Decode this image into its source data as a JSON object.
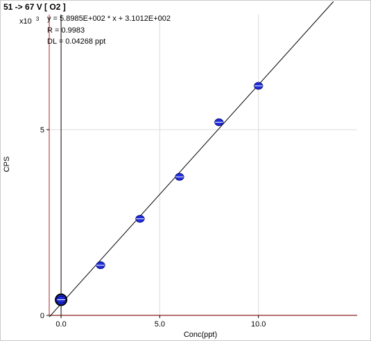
{
  "chart_data": {
    "type": "scatter",
    "title": "51 -> 67  V  [ O2 ]",
    "xlabel": "Conc(ppt)",
    "ylabel": "CPS",
    "y_scale_label": "x10",
    "y_scale_exponent": "3",
    "annotations": [
      "y = 5.8985E+002 * x  + 3.1012E+002",
      "R = 0.9983",
      "DL = 0.04268 ppt"
    ],
    "xlim": [
      -0.6,
      15.0
    ],
    "ylim": [
      0,
      8.1
    ],
    "x_ticks": [
      {
        "value": 0,
        "label": "0.0"
      },
      {
        "value": 5,
        "label": "5.0"
      },
      {
        "value": 10,
        "label": "10.0"
      }
    ],
    "y_ticks": [
      {
        "value": 0,
        "label": "0"
      },
      {
        "value": 5,
        "label": "5"
      }
    ],
    "grid": true,
    "fit_line": {
      "slope": 0.58985,
      "intercept": 0.31012,
      "x_range": [
        -0.6,
        15.0
      ]
    },
    "series": [
      {
        "x": [
          0,
          2,
          4,
          6,
          8,
          10
        ],
        "y": [
          0.42,
          1.35,
          2.6,
          3.73,
          5.2,
          6.18
        ]
      }
    ],
    "blank_marker": {
      "x": 0,
      "y": 0.42
    },
    "colors": {
      "point": "#1f2ed8",
      "point_edge": "#0a0a80",
      "fit_line": "#000000",
      "x_zero_line": "#000000",
      "y_axis_line": "#b22222",
      "x_axis_line": "#8b1a1a",
      "grid": "#dcdcdc"
    }
  }
}
